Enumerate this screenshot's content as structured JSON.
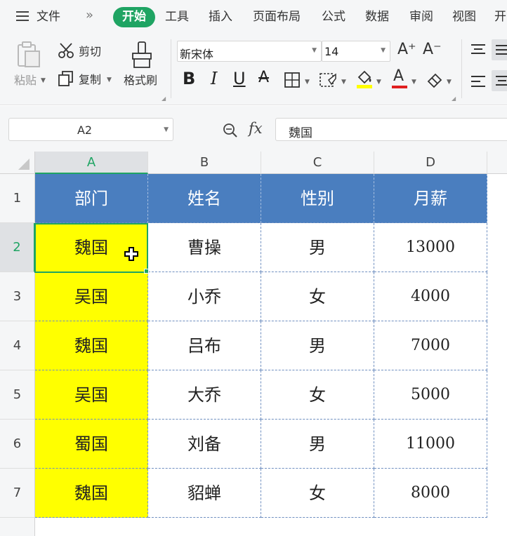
{
  "menu": {
    "file": "文件",
    "more": "»",
    "tabs": [
      "开始",
      "工具",
      "插入",
      "页面布局",
      "公式",
      "数据",
      "审阅",
      "视图",
      "开"
    ]
  },
  "ribbon": {
    "paste": "粘贴",
    "cut": "剪切",
    "copy": "复制",
    "format_painter": "格式刷",
    "font_name": "新宋体",
    "font_size": "14",
    "grow_font": "A⁺",
    "shrink_font": "A⁻",
    "bold": "B",
    "italic": "I",
    "underline": "U",
    "strike": "A",
    "font_color_glyph": "A",
    "font_color": "#e02020",
    "fill_color": "#ffff00"
  },
  "formula": {
    "cell_ref": "A2",
    "fx": "fx",
    "value": "魏国"
  },
  "grid": {
    "columns": [
      "A",
      "B",
      "C",
      "D"
    ],
    "rows": [
      "1",
      "2",
      "3",
      "4",
      "5",
      "6",
      "7"
    ],
    "header_row": [
      "部门",
      "姓名",
      "性别",
      "月薪"
    ],
    "data": [
      [
        "魏国",
        "曹操",
        "男",
        "13000"
      ],
      [
        "吴国",
        "小乔",
        "女",
        "4000"
      ],
      [
        "魏国",
        "吕布",
        "男",
        "7000"
      ],
      [
        "吴国",
        "大乔",
        "女",
        "5000"
      ],
      [
        "蜀国",
        "刘备",
        "男",
        "11000"
      ],
      [
        "魏国",
        "貂蝉",
        "女",
        "8000"
      ]
    ],
    "selected_cell": "A2",
    "header_fill": "#4a7ebf",
    "highlight_fill": "#ffff00",
    "accent": "#1fa463"
  }
}
